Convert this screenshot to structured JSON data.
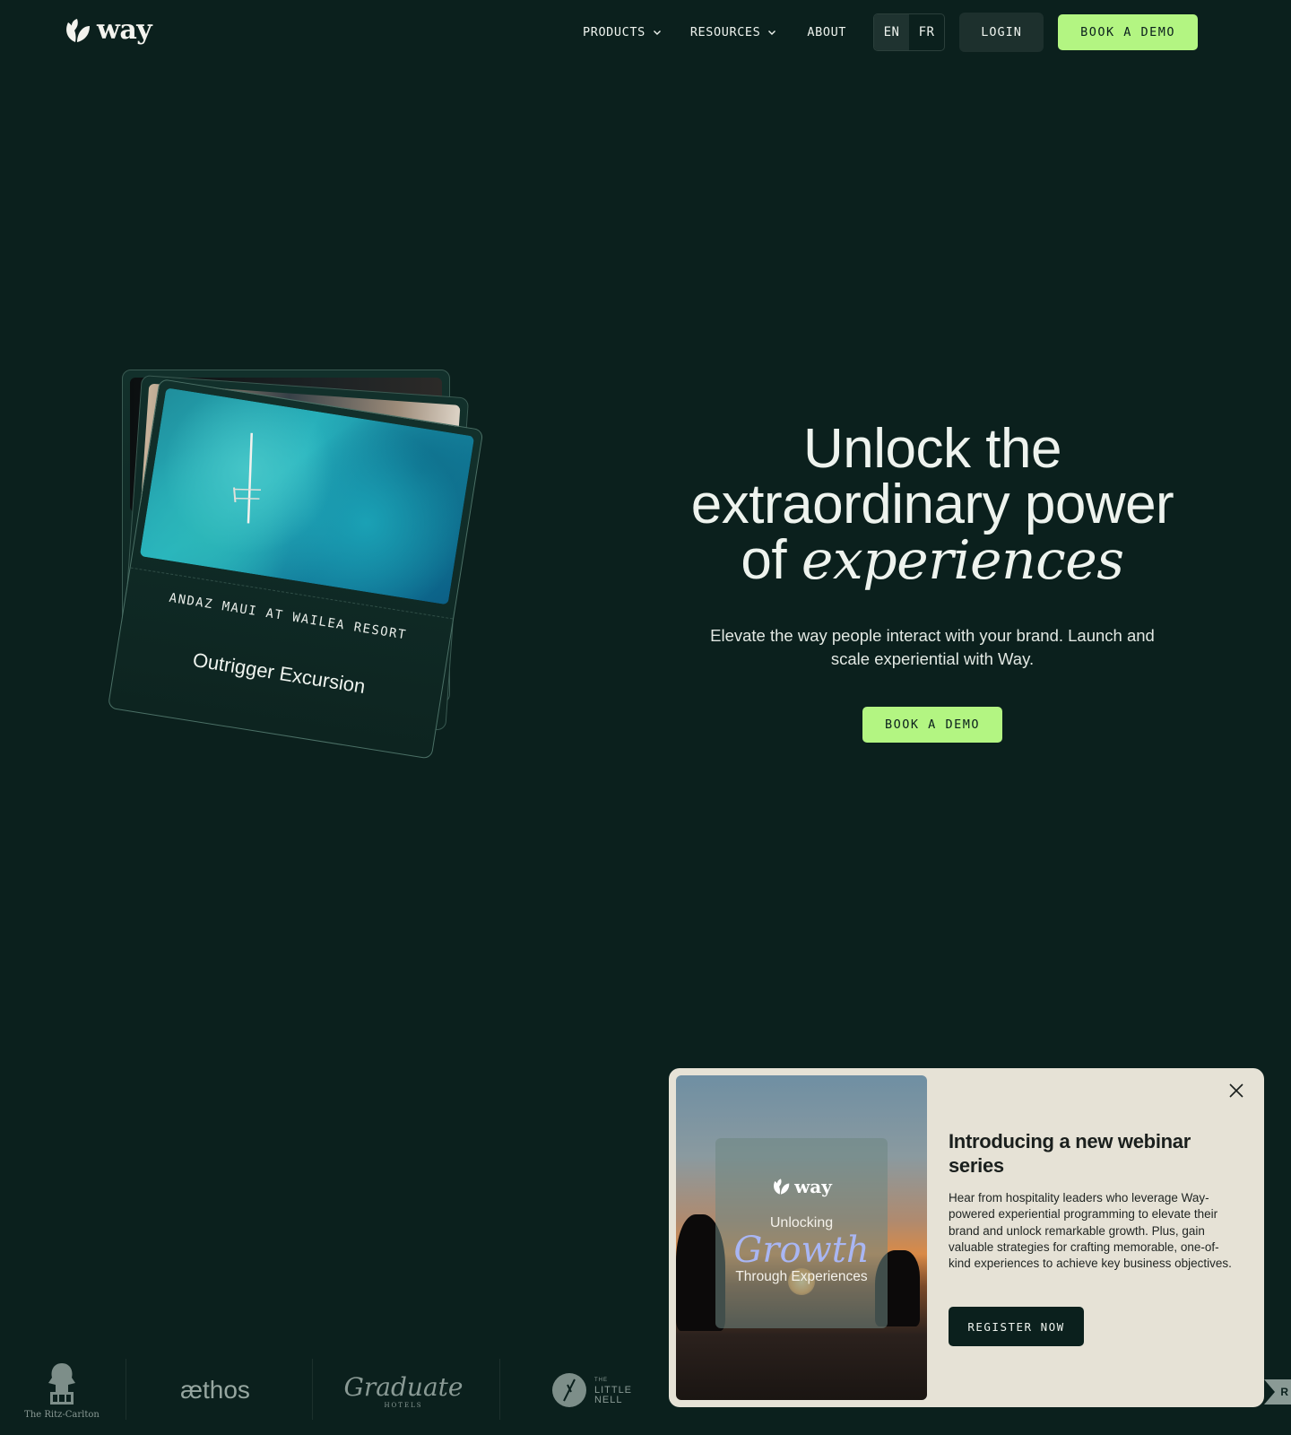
{
  "header": {
    "logo_text": "way",
    "nav": [
      {
        "label": "PRODUCTS",
        "has_dropdown": true
      },
      {
        "label": "RESOURCES",
        "has_dropdown": true
      },
      {
        "label": "ABOUT",
        "has_dropdown": false
      }
    ],
    "languages": [
      {
        "label": "EN",
        "active": true
      },
      {
        "label": "FR",
        "active": false
      }
    ],
    "login_label": "LOGIN",
    "demo_label": "BOOK A DEMO"
  },
  "hero_card": {
    "subtitle": "ANDAZ MAUI AT WAILEA RESORT",
    "title": "Outrigger Excursion"
  },
  "hero": {
    "title_line1": "Unlock the",
    "title_line2": "extraordinary power",
    "title_line3_prefix": "of",
    "title_line3_italic": "experiences",
    "subtitle": "Elevate the way people interact with your brand. Launch and scale experiential with Way.",
    "cta_label": "BOOK A DEMO"
  },
  "logos": {
    "ritz": "The Ritz-Carlton",
    "aethos": "æthos",
    "graduate": "Graduate",
    "graduate_sub": "HOTELS",
    "little_nell_the": "THE",
    "little_nell_1": "LITTLE",
    "little_nell_2": "NELL",
    "edge_letter": "R"
  },
  "popup": {
    "image_logo": "way",
    "image_line1": "Unlocking",
    "image_line2": "Growth",
    "image_line3": "Through Experiences",
    "title": "Introducing a new webinar series",
    "body": "Hear from hospitality leaders who leverage Way-powered experiential programming to elevate their brand and unlock remarkable growth. Plus, gain valuable strategies for crafting memorable, one-of-kind experiences to achieve key business objectives.",
    "cta_label": "REGISTER NOW"
  },
  "colors": {
    "background": "#0b201d",
    "accent": "#b3f582",
    "popup_bg": "#e6e2d6"
  }
}
